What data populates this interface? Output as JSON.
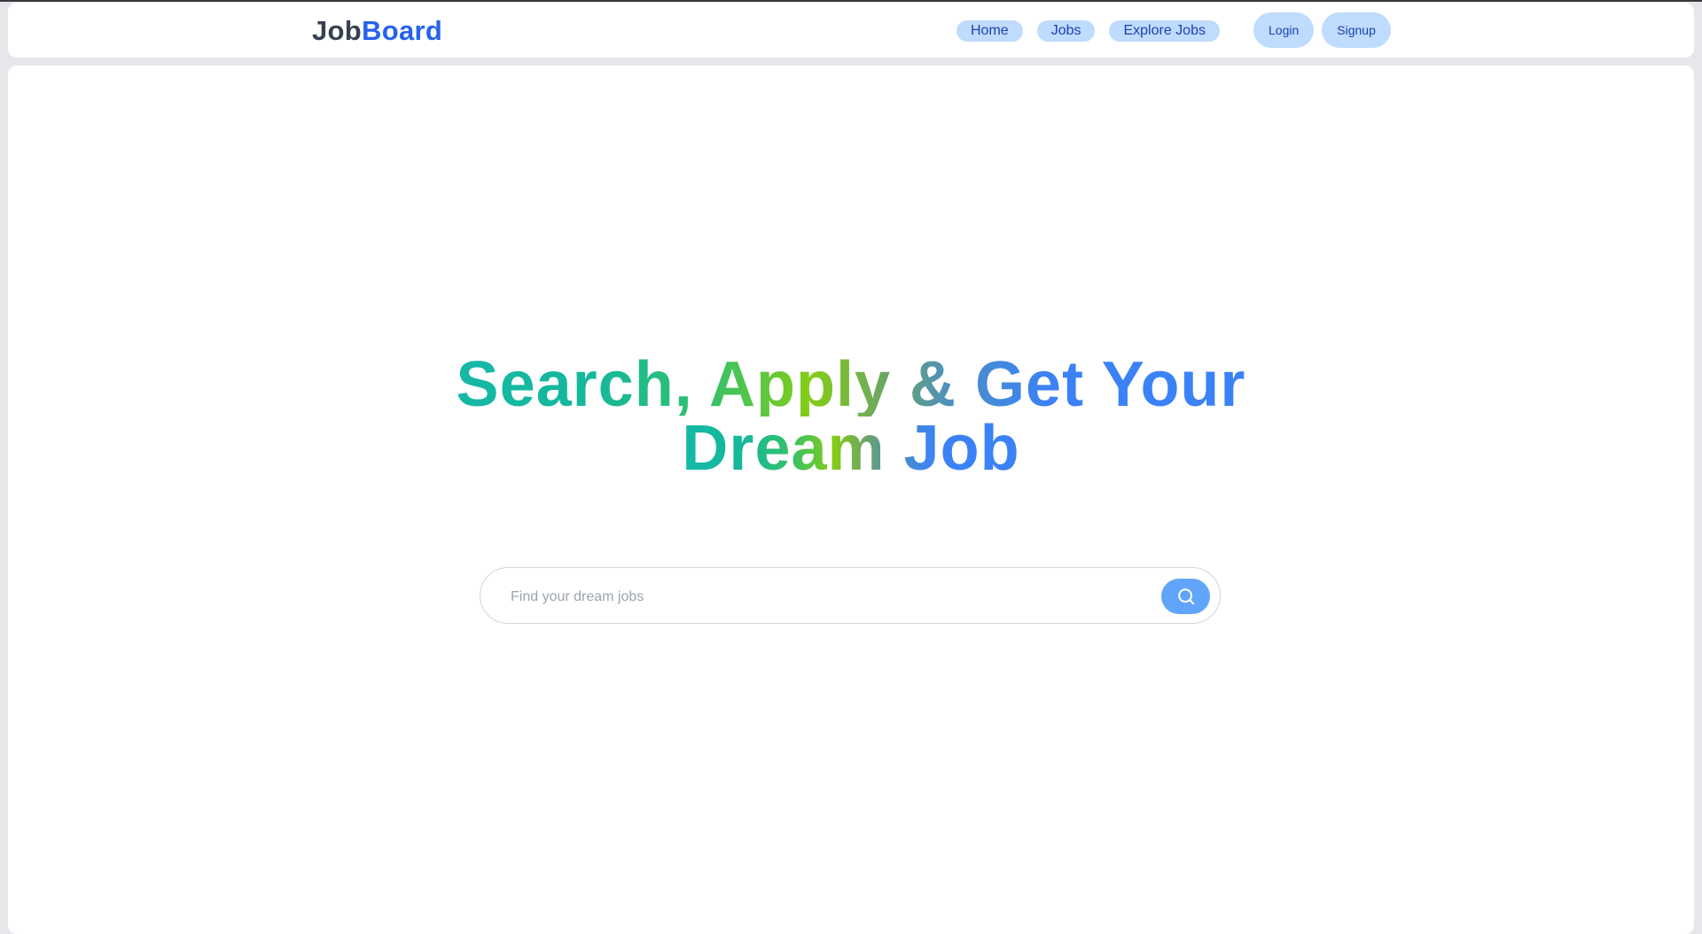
{
  "header": {
    "logo_part1": "Job",
    "logo_part2": "Board",
    "nav": [
      "Home",
      "Jobs",
      "Explore Jobs"
    ],
    "login_label": "Login",
    "signup_label": "Signup"
  },
  "hero": {
    "line1": "Search, Apply & Get Your",
    "line2": "Dream Job"
  },
  "search": {
    "placeholder": "Find your dream jobs",
    "value": "",
    "icon": "search-icon"
  },
  "colors": {
    "brand": "#2563eb",
    "pill_bg": "#bfdbfe",
    "search_button": "#60a5fa",
    "gradient": [
      "#14b8a6",
      "#84cc16",
      "#3b82f6"
    ]
  }
}
